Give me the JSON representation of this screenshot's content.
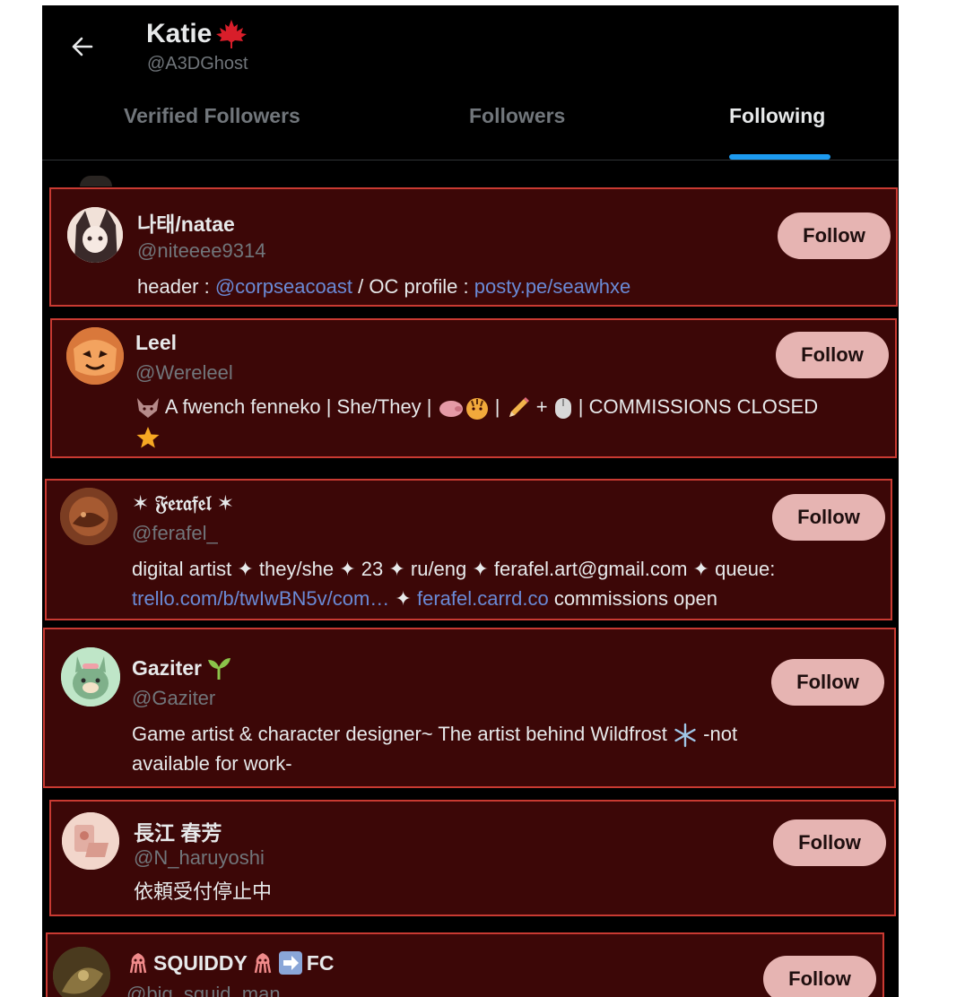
{
  "header": {
    "back_icon": "arrow-left-icon",
    "display_name": "Katie",
    "name_emoji": "maple-leaf-icon",
    "handle": "@A3DGhost"
  },
  "tabs": [
    {
      "label": "Verified Followers",
      "active": false
    },
    {
      "label": "Followers",
      "active": false
    },
    {
      "label": "Following",
      "active": true
    }
  ],
  "colors": {
    "background": "#000000",
    "card_background": "#3c0707",
    "card_border": "#c93a32",
    "follow_button": "#e6b4b2",
    "link": "#6a8ad6",
    "tab_indicator": "#1d9bf0",
    "muted_text": "#71767b"
  },
  "users": [
    {
      "name": "나태/natae",
      "handle": "@niteeee9314",
      "bio_parts": [
        "header : ",
        "@corpseacoast",
        " / OC profile : ",
        "posty.pe/seawhxe"
      ],
      "follow_label": "Follow"
    },
    {
      "name": "Leel",
      "handle": "@Wereleel",
      "bio_parts": [
        " A fwench fenneko | She/They | ",
        " | ",
        " + ",
        " | COMMISSIONS CLOSED"
      ],
      "bio_icons": [
        "fox-emoji-icon",
        "piggy-emoji-icon",
        "tiger-emoji-icon",
        "pencil-emoji-icon",
        "mouse-emoji-icon",
        "star-emoji-icon"
      ],
      "follow_label": "Follow"
    },
    {
      "name": "✶ 𝔉𝔢𝔯𝔞𝔣𝔢𝔩 ✶",
      "handle": "@ferafel_",
      "bio_parts": [
        "digital artist ✦ they/she ✦ 23 ✦ ru/eng ✦ ferafel.art@gmail.com ✦ queue:",
        "trello.com/b/twIwBN5v/com…",
        " ✦ ",
        "ferafel.carrd.co",
        " commissions open"
      ],
      "follow_label": "Follow"
    },
    {
      "name": "Gaziter",
      "name_icon": "seedling-emoji-icon",
      "handle": "@Gaziter",
      "bio_parts": [
        "Game artist & character designer~ The artist behind Wildfrost ",
        " -not",
        "available for work-"
      ],
      "bio_icons": [
        "snowflake-emoji-icon"
      ],
      "follow_label": "Follow"
    },
    {
      "name": "長江 春芳",
      "handle": "@N_haruyoshi",
      "bio_parts": [
        "依頼受付停止中"
      ],
      "follow_label": "Follow"
    },
    {
      "name": "SQUIDDY",
      "name_suffix": "FC",
      "name_icons": [
        "squid-emoji-icon",
        "squid-emoji-icon",
        "arrow-right-emoji-icon"
      ],
      "handle": "@big_squid_man",
      "follow_label": "Follow"
    }
  ]
}
